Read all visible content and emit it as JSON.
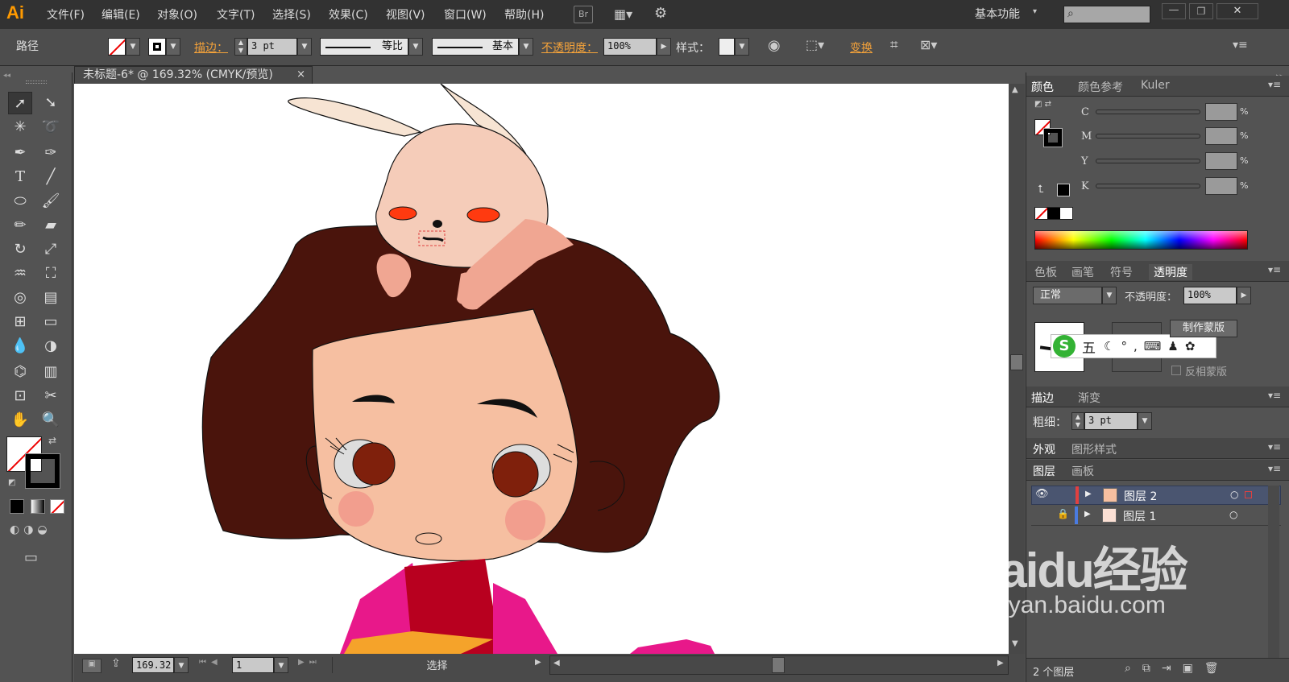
{
  "app": {
    "logo": "Ai",
    "workspace": "基本功能"
  },
  "menu": [
    "文件(F)",
    "编辑(E)",
    "对象(O)",
    "文字(T)",
    "选择(S)",
    "效果(C)",
    "视图(V)",
    "窗口(W)",
    "帮助(H)"
  ],
  "menu_extra": {
    "br": "Br"
  },
  "control": {
    "object_type": "路径",
    "stroke_label": "描边：",
    "stroke_weight": "3 pt",
    "profile": "等比",
    "brush": "基本",
    "opacity_label": "不透明度：",
    "opacity": "100%",
    "style_label": "样式：",
    "transform_label": "变换"
  },
  "document": {
    "tab_title": "未标题-6* @ 169.32% (CMYK/预览)",
    "close": "×"
  },
  "status": {
    "zoom": "169.32",
    "artboard": "1",
    "tool": "选择"
  },
  "color_panel": {
    "tabs": [
      "颜色",
      "颜色参考",
      "Kuler"
    ],
    "channels": [
      "C",
      "M",
      "Y",
      "K"
    ],
    "pct": "%"
  },
  "transparency_panel": {
    "tabs": [
      "色板",
      "画笔",
      "符号",
      "透明度"
    ],
    "blend_mode": "正常",
    "opacity_label": "不透明度：",
    "opacity": "100%",
    "make_mask": "制作蒙版",
    "invert_mask": "反相蒙版"
  },
  "ime_bar": {
    "mode": "五"
  },
  "stroke_panel": {
    "tabs": [
      "描边",
      "渐变"
    ],
    "weight_label": "粗细：",
    "weight": "3 pt"
  },
  "appearance_tabs": [
    "外观",
    "图形样式"
  ],
  "layers_panel": {
    "tabs": [
      "图层",
      "画板"
    ],
    "layers": [
      {
        "name": "图层 2",
        "color": "#e04040",
        "selected": true
      },
      {
        "name": "图层 1",
        "color": "#4a7be0",
        "selected": false
      }
    ],
    "count": "2 个图层"
  },
  "watermark": {
    "brand": "Baidu经验",
    "url": "jingyan.baidu.com"
  },
  "colors": {
    "accent": "#ff9a00",
    "hair": "#4a140c",
    "skin": "#f6bfa1",
    "bunny": "#f5ccb9",
    "bunny_ear": "#f7e4d3",
    "pupil": "#7f200c",
    "cheek": "#f29e8e",
    "bunny_eye": "#ff3a10",
    "collar": "#b8001f",
    "dress": "#e8188a",
    "orange": "#f5a32a",
    "paw": "#f0a692"
  }
}
